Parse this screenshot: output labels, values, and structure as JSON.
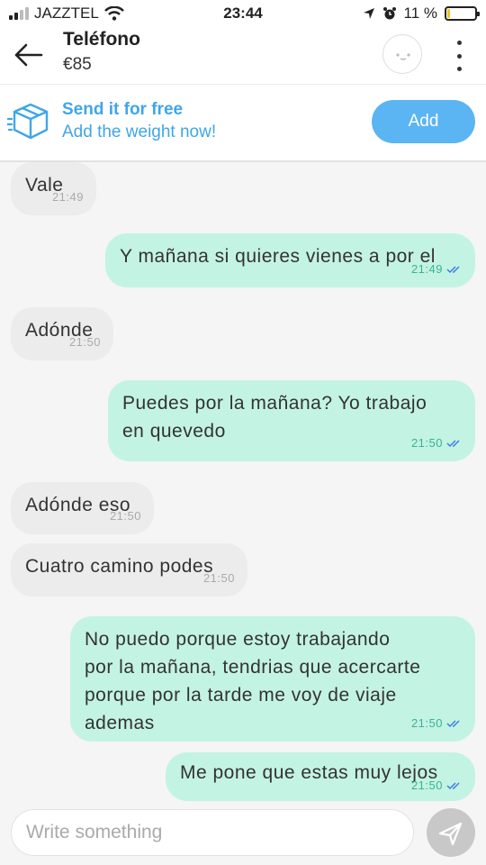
{
  "status_bar": {
    "carrier": "JAZZTEL",
    "time": "23:44",
    "battery_percent": "11 %",
    "battery_level": 0.11
  },
  "header": {
    "title": "Teléfono",
    "price": "€85"
  },
  "promo": {
    "title": "Send it for free",
    "subtitle": "Add the weight now!",
    "button": "Add"
  },
  "messages": [
    {
      "dir": "in",
      "lines": [
        "Vale"
      ],
      "time": "21:49"
    },
    {
      "dir": "out",
      "lines": [
        "Y mañana si quieres vienes a por el"
      ],
      "time": "21:49"
    },
    {
      "dir": "in",
      "lines": [
        "Adónde"
      ],
      "time": "21:50"
    },
    {
      "dir": "out",
      "lines": [
        "Puedes por la mañana? Yo trabajo",
        "en quevedo"
      ],
      "time": "21:50"
    },
    {
      "dir": "in",
      "lines": [
        "Adónde eso"
      ],
      "time": "21:50"
    },
    {
      "dir": "in",
      "lines": [
        "Cuatro camino podes"
      ],
      "time": "21:50"
    },
    {
      "dir": "out",
      "lines": [
        "No puedo porque estoy trabajando",
        "por la mañana, tendrias que acercarte",
        "porque por la tarde me voy de viaje",
        "ademas"
      ],
      "time": "21:50"
    },
    {
      "dir": "out",
      "lines": [
        "Me pone que estas muy lejos"
      ],
      "time": "21:50"
    }
  ],
  "composer": {
    "placeholder": "Write something"
  },
  "colors": {
    "accent": "#5ab5f2",
    "outgoing_bubble": "#c3f3e3",
    "incoming_bubble": "#ececec",
    "read_ticks": "#3d7fe0"
  },
  "icons": [
    "signal-icon",
    "wifi-icon",
    "location-icon",
    "alarm-icon",
    "battery-icon",
    "back-arrow-icon",
    "box-icon",
    "more-icon",
    "read-ticks-icon",
    "send-icon"
  ]
}
